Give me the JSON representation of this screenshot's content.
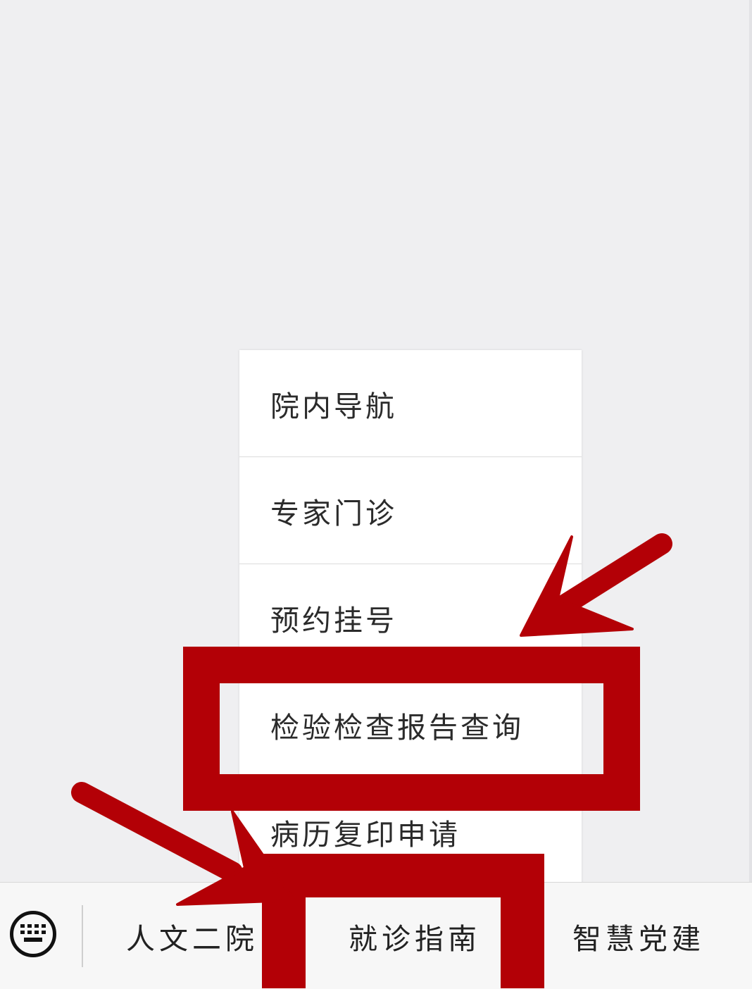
{
  "colors": {
    "background": "#efeff1",
    "menu_bg": "#ffffff",
    "bar_bg": "#f7f7f7",
    "annotation_red": "#b30006",
    "text": "#222222"
  },
  "submenu": {
    "items": [
      {
        "label": "院内导航"
      },
      {
        "label": "专家门诊"
      },
      {
        "label": "预约挂号"
      },
      {
        "label": "检验检查报告查询"
      },
      {
        "label": "病历复印申请"
      }
    ]
  },
  "bottom_bar": {
    "keyboard_icon": "keyboard-icon",
    "tabs": [
      {
        "label": "人文二院"
      },
      {
        "label": "就诊指南"
      },
      {
        "label": "智慧党建"
      }
    ]
  },
  "annotations": {
    "highlighted_menu_item": "检验检查报告查询",
    "highlighted_tab": "就诊指南"
  }
}
